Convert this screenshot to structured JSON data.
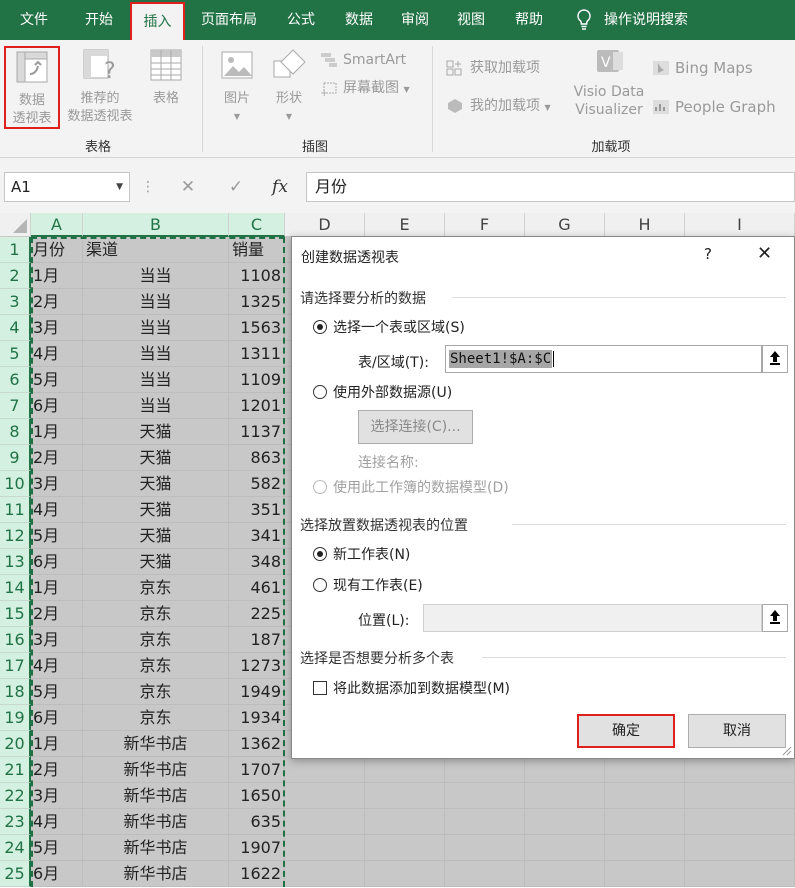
{
  "menu": {
    "tabs": [
      "文件",
      "开始",
      "插入",
      "页面布局",
      "公式",
      "数据",
      "审阅",
      "视图",
      "帮助"
    ],
    "active_index": 2,
    "search_label": "操作说明搜索"
  },
  "ribbon": {
    "pivot_table": [
      "数据",
      "透视表"
    ],
    "recommended_pivot": [
      "推荐的",
      "数据透视表"
    ],
    "table": "表格",
    "group_table": "表格",
    "pictures": "图片",
    "shapes": "形状",
    "smartart": "SmartArt",
    "screenshot": "屏幕截图",
    "group_illustrations": "插图",
    "get_addins": "获取加载项",
    "my_addins": "我的加载项",
    "visio": [
      "Visio Data",
      "Visualizer"
    ],
    "bing_maps": "Bing Maps",
    "people_graph": "People Graph",
    "group_addins": "加载项"
  },
  "formula_bar": {
    "name_box": "A1",
    "cancel": "✕",
    "enter": "✓",
    "fx": "fx",
    "content": "月份"
  },
  "grid": {
    "columns": [
      "A",
      "B",
      "C",
      "D",
      "E",
      "F",
      "G",
      "H",
      "I"
    ],
    "header_row": [
      "月份",
      "渠道",
      "销量"
    ],
    "rows": [
      [
        "1月",
        "当当",
        "1108"
      ],
      [
        "2月",
        "当当",
        "1325"
      ],
      [
        "3月",
        "当当",
        "1563"
      ],
      [
        "4月",
        "当当",
        "1311"
      ],
      [
        "5月",
        "当当",
        "1109"
      ],
      [
        "6月",
        "当当",
        "1201"
      ],
      [
        "1月",
        "天猫",
        "1137"
      ],
      [
        "2月",
        "天猫",
        "863"
      ],
      [
        "3月",
        "天猫",
        "582"
      ],
      [
        "4月",
        "天猫",
        "351"
      ],
      [
        "5月",
        "天猫",
        "341"
      ],
      [
        "6月",
        "天猫",
        "348"
      ],
      [
        "1月",
        "京东",
        "461"
      ],
      [
        "2月",
        "京东",
        "225"
      ],
      [
        "3月",
        "京东",
        "187"
      ],
      [
        "4月",
        "京东",
        "1273"
      ],
      [
        "5月",
        "京东",
        "1949"
      ],
      [
        "6月",
        "京东",
        "1934"
      ],
      [
        "1月",
        "新华书店",
        "1362"
      ],
      [
        "2月",
        "新华书店",
        "1707"
      ],
      [
        "3月",
        "新华书店",
        "1650"
      ],
      [
        "4月",
        "新华书店",
        "635"
      ],
      [
        "5月",
        "新华书店",
        "1907"
      ],
      [
        "6月",
        "新华书店",
        "1622"
      ]
    ],
    "row_numbers": [
      "1",
      "2",
      "3",
      "4",
      "5",
      "6",
      "7",
      "8",
      "9",
      "10",
      "11",
      "12",
      "13",
      "14",
      "15",
      "16",
      "17",
      "18",
      "19",
      "20",
      "21",
      "22",
      "23",
      "24",
      "25"
    ]
  },
  "dialog": {
    "title": "创建数据透视表",
    "help": "?",
    "close": "✕",
    "section1": "请选择要分析的数据",
    "opt_table_range": "选择一个表或区域(S)",
    "range_label": "表/区域(T):",
    "range_value": "Sheet1!$A:$C",
    "opt_external": "使用外部数据源(U)",
    "choose_connection": "选择连接(C)...",
    "connection_name": "连接名称:",
    "opt_data_model": "使用此工作簿的数据模型(D)",
    "section2": "选择放置数据透视表的位置",
    "opt_new_sheet": "新工作表(N)",
    "opt_existing_sheet": "现有工作表(E)",
    "location_label": "位置(L):",
    "location_value": "",
    "section3": "选择是否想要分析多个表",
    "add_to_model": "将此数据添加到数据模型(M)",
    "ok": "确定",
    "cancel": "取消"
  },
  "colors": {
    "excel_green": "#217346",
    "highlight_red": "#e0201d",
    "selection_gray": "#c8c8c8"
  }
}
